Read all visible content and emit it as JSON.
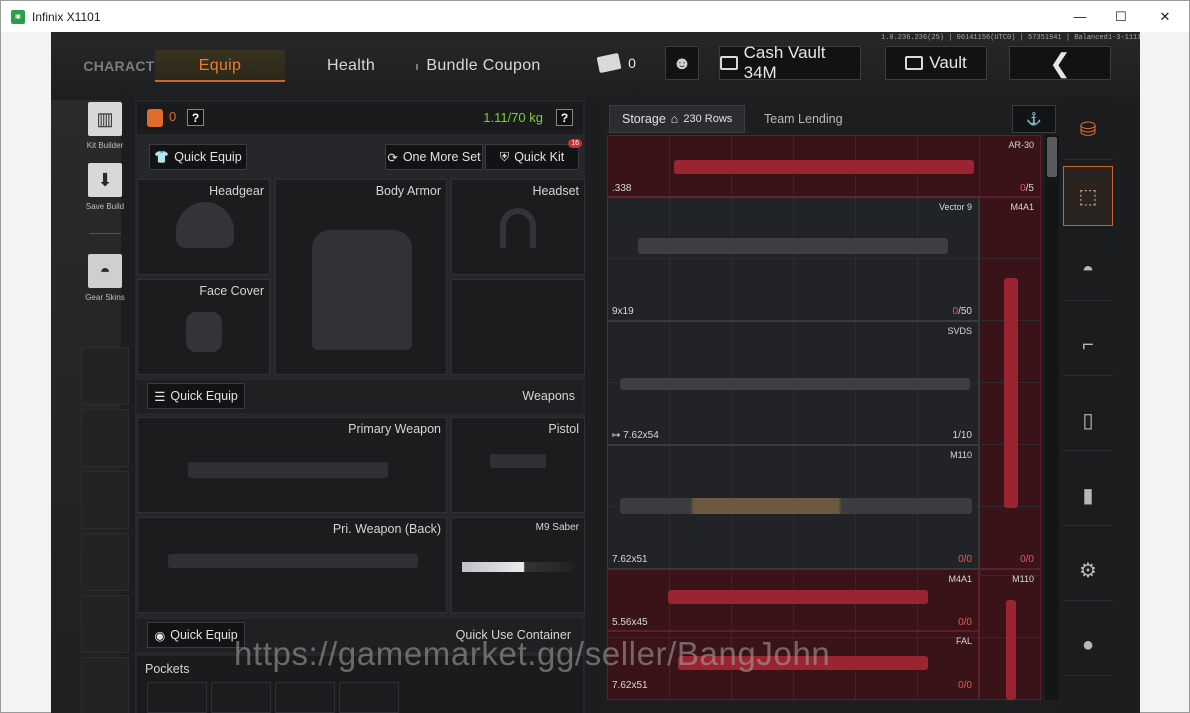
{
  "window": {
    "title": "Infinix X1101",
    "icon": "app-icon",
    "controls": {
      "minimize": "—",
      "maximize": "☐",
      "close": "✕"
    }
  },
  "version_text": "1.0.236.236(25) | 06141156(UTC0) | 57351941 | Balanced1-3-11111-11m",
  "topbar": {
    "tabs": {
      "character": "CHARACTER",
      "equip": "Equip",
      "health": "Health",
      "bundle": "Bundle Coupon"
    },
    "ticket_count": "0",
    "cash_vault": "Cash Vault 34M",
    "vault": "Vault"
  },
  "sidebar": {
    "kit_builder": "Kit Builder",
    "save_build": "Save Build",
    "gear_skins": "Gear Skins"
  },
  "equip_panel": {
    "armor_count": "0",
    "help": "?",
    "weight": "1.11/70 kg",
    "quick_equip_gear": "Quick Equip",
    "one_more_set": "One More Set",
    "quick_kit": "Quick Kit",
    "quick_kit_badge": "16",
    "slots": {
      "headgear": "Headgear",
      "body_armor": "Body Armor",
      "headset": "Headset",
      "face_cover": "Face Cover",
      "weapons_header": "Weapons",
      "quick_equip_weapons": "Quick Equip",
      "primary": "Primary Weapon",
      "pistol": "Pistol",
      "primary_back": "Pri. Weapon (Back)",
      "melee": "M9 Saber",
      "quick_equip_container": "Quick Equip",
      "quick_use_container": "Quick Use Container",
      "pockets": "Pockets"
    }
  },
  "storage": {
    "tab_storage": "Storage",
    "rows": "230 Rows",
    "tab_team_lending": "Team Lending",
    "items": [
      {
        "name": "AR-30",
        "caliber": ".338",
        "count_red": "0",
        "count_rest": "/5"
      },
      {
        "name": "Vector 9",
        "caliber": "9x19",
        "count_red": "0",
        "count_rest": "/50"
      },
      {
        "name": "M4A1",
        "caliber": "",
        "count_red": "0",
        "count_rest": "/0"
      },
      {
        "name": "SVDS",
        "caliber": "7.62x54",
        "count_red": "",
        "count_rest": "1/10"
      },
      {
        "name": "M110",
        "caliber": "7.62x51",
        "count_red": "0",
        "count_rest": "/0"
      },
      {
        "name": "M4A1",
        "caliber": "5.56x45",
        "count_red": "0",
        "count_rest": "/0"
      },
      {
        "name": "M110",
        "caliber": "",
        "count_red": "",
        "count_rest": ""
      },
      {
        "name": "FAL",
        "caliber": "7.62x51",
        "count_red": "0",
        "count_rest": "/0"
      }
    ]
  },
  "watermark": "https://gamemarket.gg/seller/BangJohn",
  "colors": {
    "accent": "#f07c2a",
    "weight_green": "#7ccc3a",
    "red_item": "#3a1318",
    "count_red": "#e05b5b"
  }
}
